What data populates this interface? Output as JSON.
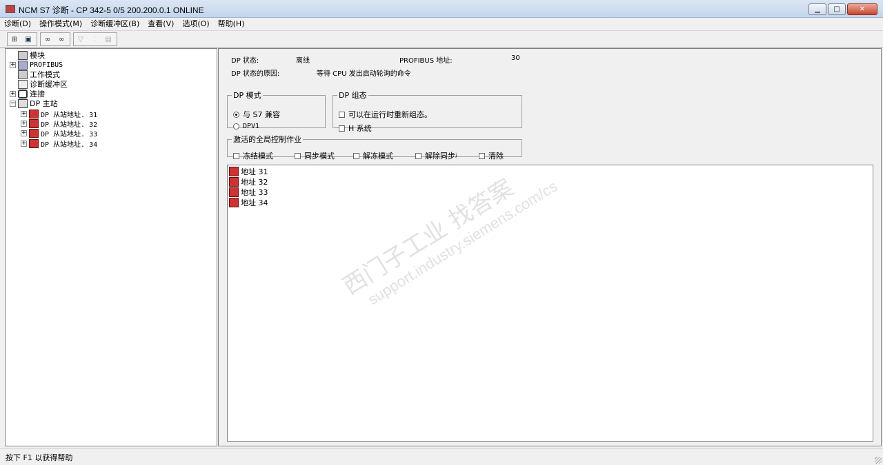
{
  "window": {
    "title": "NCM S7 诊断 - CP 342-5 0/5 200.200.0.1  ONLINE",
    "buttons": {
      "minimize": "▁",
      "maximize": "□",
      "close": "✕"
    }
  },
  "menu": [
    "诊断(D)",
    "操作模式(M)",
    "诊断缓冲区(B)",
    "查看(V)",
    "选项(O)",
    "帮助(H)"
  ],
  "toolbar": {
    "icons": [
      "station-icon",
      "module-icon",
      "watch-icon",
      "watch2-icon",
      "filter-icon",
      "io-icon",
      "table-icon"
    ]
  },
  "tree": {
    "items": [
      {
        "label": "模块",
        "level": 0,
        "expander": ""
      },
      {
        "label": "PROFIBUS",
        "level": 0,
        "expander": "+"
      },
      {
        "label": "工作模式",
        "level": 0,
        "expander": ""
      },
      {
        "label": "诊断缓冲区",
        "level": 0,
        "expander": ""
      },
      {
        "label": "连接",
        "level": 0,
        "expander": "+"
      },
      {
        "label": "DP 主站",
        "level": 0,
        "expander": "−"
      },
      {
        "label": "DP 从站地址. 31",
        "level": 1,
        "expander": "+"
      },
      {
        "label": "DP 从站地址. 32",
        "level": 1,
        "expander": "+"
      },
      {
        "label": "DP 从站地址. 33",
        "level": 1,
        "expander": "+"
      },
      {
        "label": "DP 从站地址. 34",
        "level": 1,
        "expander": "+"
      }
    ]
  },
  "status": {
    "dp_state_label": "DP 状态:",
    "dp_state_value": "离线",
    "profibus_addr_label": "PROFIBUS 地址:",
    "profibus_addr_value": "30",
    "reason_label": "DP 状态的原因:",
    "reason_value": "等待 CPU 发出启动轮询的命令"
  },
  "dp_mode": {
    "legend": "DP 模式",
    "options": [
      {
        "label": "与 S7 兼容",
        "selected": true
      },
      {
        "label": "DPV1",
        "selected": false
      }
    ]
  },
  "dp_config": {
    "legend": "DP 组态",
    "options": [
      {
        "label": "可以在运行时重新组态。",
        "checked": false
      },
      {
        "label": "H 系统",
        "checked": false
      }
    ]
  },
  "global_control": {
    "legend": "激活的全局控制作业",
    "options": [
      {
        "label": "冻结模式",
        "checked": false
      },
      {
        "label": "同步模式",
        "checked": false
      },
      {
        "label": "解冻模式",
        "checked": false
      },
      {
        "label": "解除同步模式",
        "checked": false
      },
      {
        "label": "清除",
        "checked": false
      }
    ]
  },
  "address_list": [
    "地址 31",
    "地址 32",
    "地址 33",
    "地址 34"
  ],
  "watermark": {
    "line1": "西门子工业  找答案",
    "line2": "support.industry.siemens.com/cs"
  },
  "statusbar": {
    "text": "按下 F1 以获得帮助"
  },
  "colors": {
    "offline_icon": "#cc3333",
    "title_gradient_top": "#dbe6f4"
  }
}
